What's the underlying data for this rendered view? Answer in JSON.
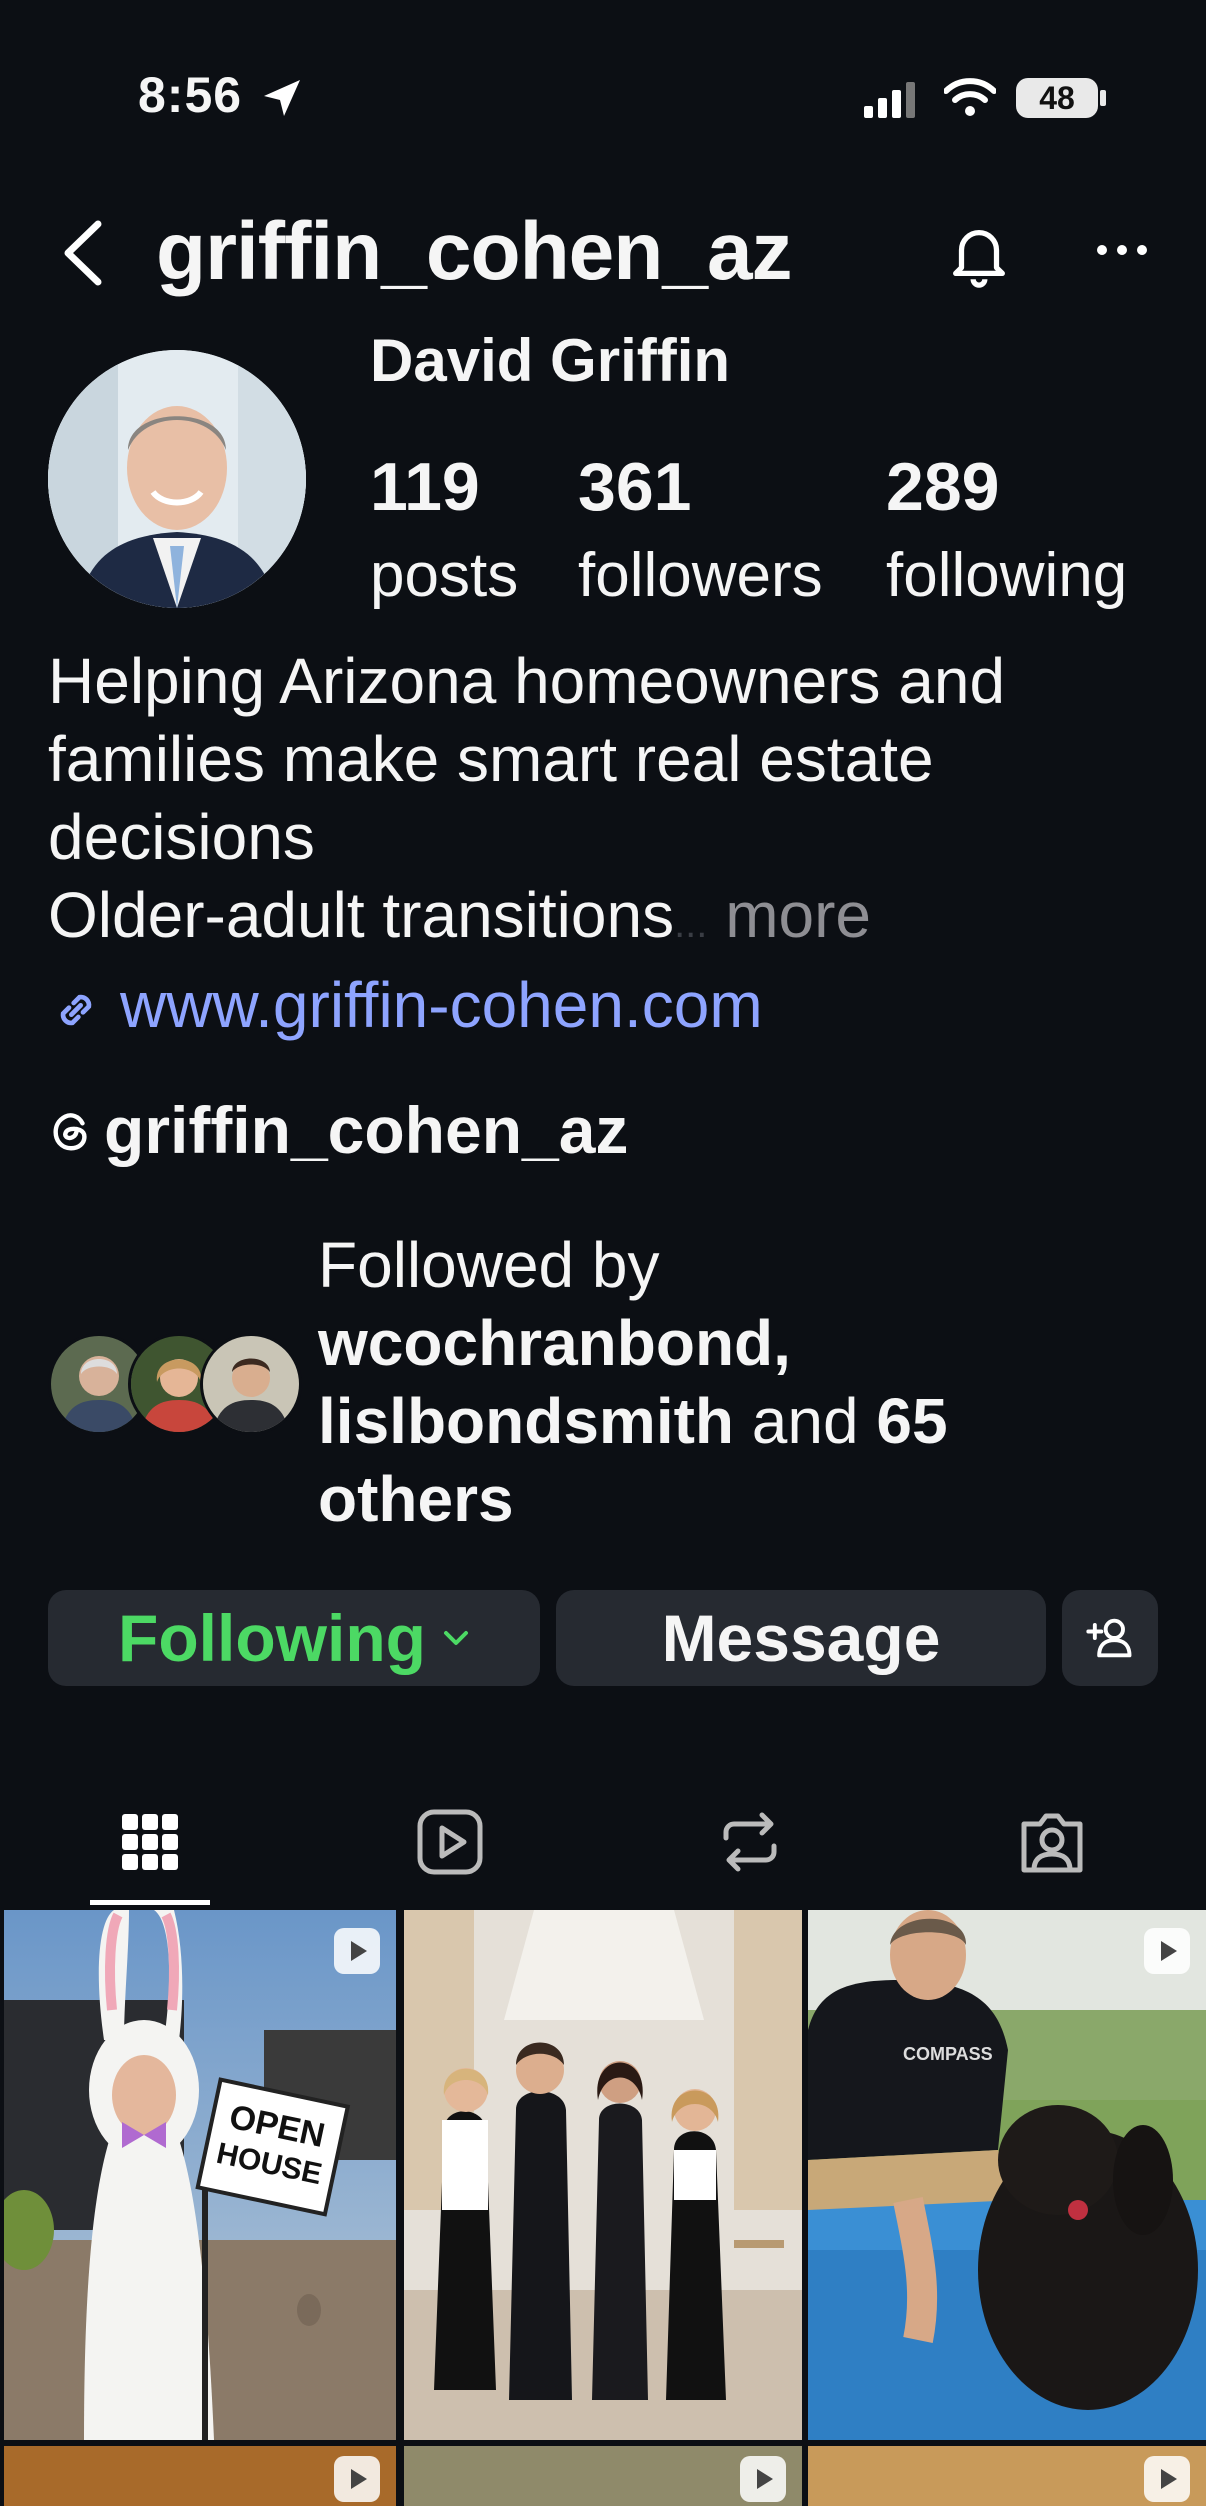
{
  "status_bar": {
    "time": "8:56",
    "battery": "48"
  },
  "header": {
    "username": "griffin_cohen_az"
  },
  "profile": {
    "display_name": "David Griffin",
    "stats": [
      {
        "value": "119",
        "label": "posts"
      },
      {
        "value": "361",
        "label": "followers"
      },
      {
        "value": "289",
        "label": "following"
      }
    ],
    "bio_lines": [
      "Helping Arizona homeowners and",
      "families make smart real estate",
      "decisions",
      "Older-adult transitions"
    ],
    "bio_more": "more",
    "bio_ellipsis": "...",
    "website": "www.griffin-cohen.com",
    "threads_handle": "griffin_cohen_az"
  },
  "followed_by": {
    "prefix": "Followed by",
    "user1": "wcochranbond,",
    "user2": "lislbondsmith",
    "conjunction": "and",
    "count": "65",
    "suffix": "others"
  },
  "actions": {
    "following": "Following",
    "message": "Message"
  },
  "colors": {
    "background": "#0c0f14",
    "button": "#262a31",
    "following_green": "#4cd964",
    "link": "#8ea4ff"
  },
  "tabs": [
    "grid-icon",
    "reels-icon",
    "reposts-icon",
    "tagged-icon"
  ],
  "grid_posts": [
    {
      "caption_sign": "OPEN HOUSE",
      "type": "reel"
    },
    {
      "type": "photo"
    },
    {
      "shirt_text": "COMPASS",
      "type": "reel"
    }
  ]
}
